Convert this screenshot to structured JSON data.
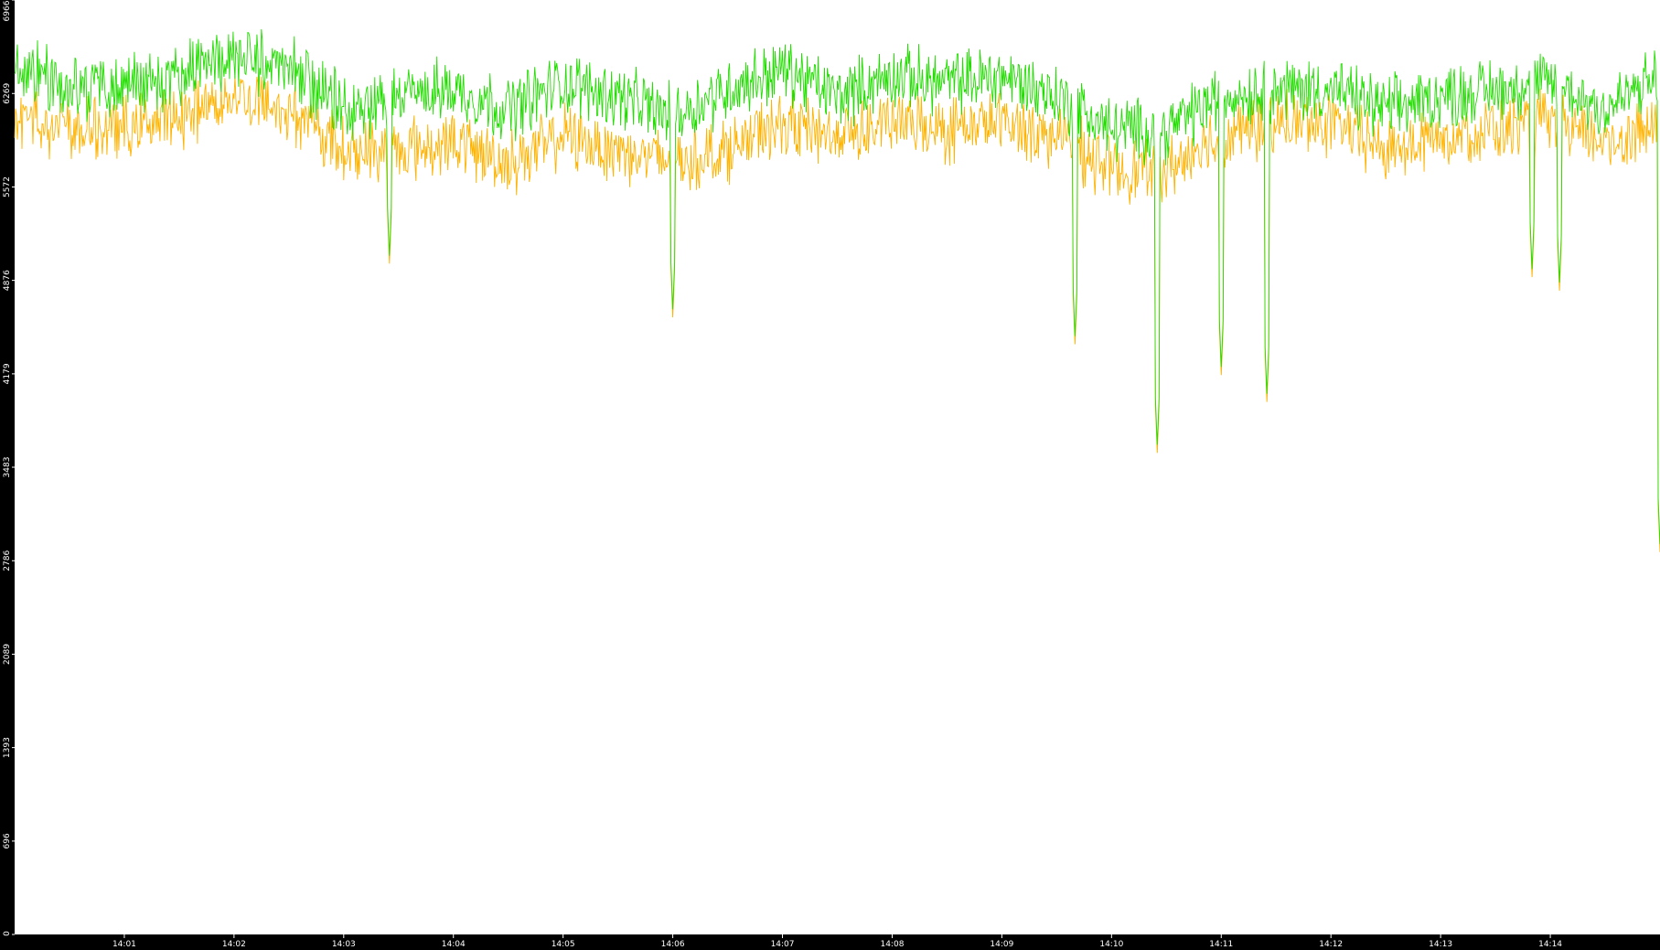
{
  "chart_data": {
    "type": "line",
    "title": "",
    "xlabel": "",
    "ylabel": "",
    "ylim": [
      0,
      6966
    ],
    "x_range": [
      "14:00",
      "14:15"
    ],
    "y_ticks": [
      "0",
      "696",
      "1393",
      "2089",
      "2786",
      "3483",
      "4179",
      "4876",
      "5572",
      "6269",
      "6966"
    ],
    "x_ticks": [
      "14:01",
      "14:02",
      "14:03",
      "14:04",
      "14:05",
      "14:06",
      "14:07",
      "14:08",
      "14:09",
      "14:10",
      "14:11",
      "14:12",
      "14:13",
      "14:14"
    ],
    "grid": false,
    "legend": "none",
    "colors": {
      "background": "#000000",
      "plot_area": "#ffffff",
      "series_a": "#22dd00",
      "series_b": "#ffb300"
    },
    "series": [
      {
        "color": "#22dd00",
        "x": [
          "14:00",
          "14:00:30",
          "14:01",
          "14:01:30",
          "14:02",
          "14:02:30",
          "14:03",
          "14:03:30",
          "14:04",
          "14:04:30",
          "14:05",
          "14:05:30",
          "14:06",
          "14:06:30",
          "14:07",
          "14:07:30",
          "14:08",
          "14:08:30",
          "14:09",
          "14:09:30",
          "14:10",
          "14:10:30",
          "14:11",
          "14:11:30",
          "14:12",
          "14:12:30",
          "14:13",
          "14:13:30",
          "14:14",
          "14:14:30",
          "14:15"
        ],
        "values": [
          6500,
          6300,
          6350,
          6400,
          6550,
          6450,
          6150,
          6250,
          6300,
          6150,
          6350,
          6250,
          6100,
          6300,
          6450,
          6250,
          6400,
          6350,
          6400,
          6250,
          6000,
          6000,
          6250,
          6300,
          6300,
          6150,
          6250,
          6300,
          6350,
          6150,
          6400
        ]
      },
      {
        "color": "#ffb300",
        "x": [
          "14:00",
          "14:00:30",
          "14:01",
          "14:01:30",
          "14:02",
          "14:02:30",
          "14:03",
          "14:03:30",
          "14:04",
          "14:04:30",
          "14:05",
          "14:05:30",
          "14:06",
          "14:06:30",
          "14:07",
          "14:07:30",
          "14:08",
          "14:08:30",
          "14:09",
          "14:09:30",
          "14:10",
          "14:10:30",
          "14:11",
          "14:11:30",
          "14:12",
          "14:12:30",
          "14:13",
          "14:13:30",
          "14:14",
          "14:14:30",
          "14:15"
        ],
        "values": [
          6100,
          6000,
          6000,
          6100,
          6250,
          6150,
          5850,
          5850,
          5900,
          5750,
          5950,
          5850,
          5750,
          5850,
          6050,
          5950,
          6050,
          6000,
          6050,
          5950,
          5700,
          5700,
          5950,
          6050,
          6050,
          5850,
          5950,
          6000,
          6050,
          5900,
          6050
        ]
      }
    ],
    "dips": [
      {
        "x": "14:03:25",
        "value": 5000
      },
      {
        "x": "14:06",
        "value": 4600
      },
      {
        "x": "14:09:40",
        "value": 4400
      },
      {
        "x": "14:10:25",
        "value": 3590
      },
      {
        "x": "14:11",
        "value": 4170
      },
      {
        "x": "14:11:25",
        "value": 3970
      },
      {
        "x": "14:13:50",
        "value": 4900
      },
      {
        "x": "14:14:05",
        "value": 4800
      },
      {
        "x": "14:15",
        "value": 2850
      }
    ]
  }
}
